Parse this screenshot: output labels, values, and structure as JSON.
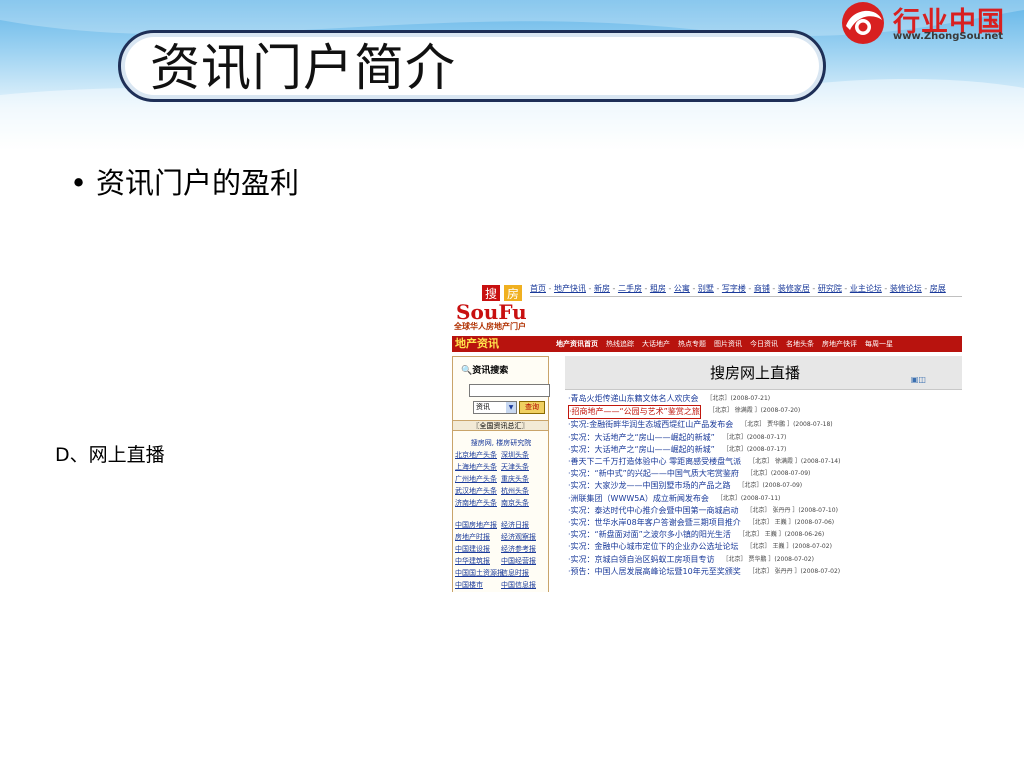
{
  "slide": {
    "title": "资讯门户简介",
    "bullet": "资讯门户的盈利",
    "label": "D、网上直播",
    "logo": {
      "name": "行业中国",
      "url": "www.ZhongSou.net"
    }
  },
  "screenshot": {
    "logo_text": "SouFun",
    "logo_cn": "搜房",
    "tagline": "全球华人房地产门户",
    "top_nav": [
      "首页",
      "地产快讯",
      "新房",
      "二手房",
      "租房",
      "公寓",
      "别墅",
      "写字楼",
      "商铺",
      "装修家居",
      "研究院",
      "业主论坛",
      "装修论坛",
      "房展"
    ],
    "section_title": "地产资讯",
    "tabs": [
      "地产资讯首页",
      "热线追踪",
      "大话地产",
      "热点专题",
      "图片资讯",
      "今日资讯",
      "名地头条",
      "房地产快评",
      "每周一星"
    ],
    "search": {
      "heading": "资讯搜索",
      "select_value": "资讯",
      "button": "查询",
      "summary": "〖全国资讯总汇〗"
    },
    "left_links_center": "搜房网, 楼房研究院",
    "left_links_1": [
      [
        "北京地产头条",
        "深圳头条"
      ],
      [
        "上海地产头条",
        "天津头条"
      ],
      [
        "广州地产头条",
        "重庆头条"
      ],
      [
        "武汉地产头条",
        "杭州头条"
      ],
      [
        "济南地产头条",
        "南京头条"
      ]
    ],
    "left_links_2": [
      [
        "中国房地产报",
        "经济日报"
      ],
      [
        "房地产时报",
        "经济观察报"
      ],
      [
        "中国建设报",
        "经济参考报"
      ],
      [
        "中华建筑报",
        "中国经营报"
      ],
      [
        "中国国土资源报",
        "信息时报"
      ],
      [
        "中国楼市",
        "中国信息报"
      ]
    ],
    "live_title": "搜房网上直播",
    "news": [
      {
        "title": "·青岛火炬传递山东籍文体名人欢庆会",
        "meta": "［北京］(2008-07-21)",
        "highlight": false
      },
      {
        "title": "·招商地产——“公园与艺术”鉴赏之旅",
        "meta": "［北京］ 徐满霞 ］(2008-07-20)",
        "highlight": true
      },
      {
        "title": "·实况:金融街畔华润生态城西堤红山产品发布会",
        "meta": "［北京］ 贾华鹏 ］(2008-07-18)",
        "highlight": false
      },
      {
        "title": "·实况：大话地产之“房山——崛起的新城”",
        "meta": "［北京］(2008-07-17)",
        "highlight": false
      },
      {
        "title": "·实况：大话地产之“房山——崛起的新城”",
        "meta": "［北京］(2008-07-17)",
        "highlight": false
      },
      {
        "title": "·善天下二千万打造体验中心 零距离感受楼盘气派",
        "meta": "［北京］ 徐满霞 ］(2008-07-14)",
        "highlight": false
      },
      {
        "title": "·实况：“新中式”的兴起——中国气质大宅赏鉴府",
        "meta": "［北京］(2008-07-09)",
        "highlight": false
      },
      {
        "title": "·实况：大家沙龙——中国别墅市场的产品之路",
        "meta": "［北京］(2008-07-09)",
        "highlight": false
      },
      {
        "title": "·洲联集团（WWW5A）成立新闻发布会",
        "meta": "［北京］(2008-07-11)",
        "highlight": false
      },
      {
        "title": "·实况：泰达时代中心推介会暨中国第一商城启动",
        "meta": "［北京］ 张丹丹 ］(2008-07-10)",
        "highlight": false
      },
      {
        "title": "·实况：世华水岸08年客户答谢会暨三期项目推介",
        "meta": "［北京］ 王巍 ］(2008-07-06)",
        "highlight": false
      },
      {
        "title": "·实况：“新盘面对面”之波尔多小镇的阳光生活",
        "meta": "［北京］ 王巍 ］(2008-06-26)",
        "highlight": false
      },
      {
        "title": "·实况：金融中心城市定位下的企业办公选址论坛",
        "meta": "［北京］ 王巍 ］(2008-07-02)",
        "highlight": false
      },
      {
        "title": "·实况：京城白领自治区蚂蚁工房项目专访",
        "meta": "［北京］ 贾华鹏 ］(2008-07-02)",
        "highlight": false
      },
      {
        "title": "·预告：中国人居发展高峰论坛暨10年元至奖颁奖",
        "meta": "［北京］ 张丹丹 ］(2008-07-02)",
        "highlight": false
      }
    ]
  }
}
